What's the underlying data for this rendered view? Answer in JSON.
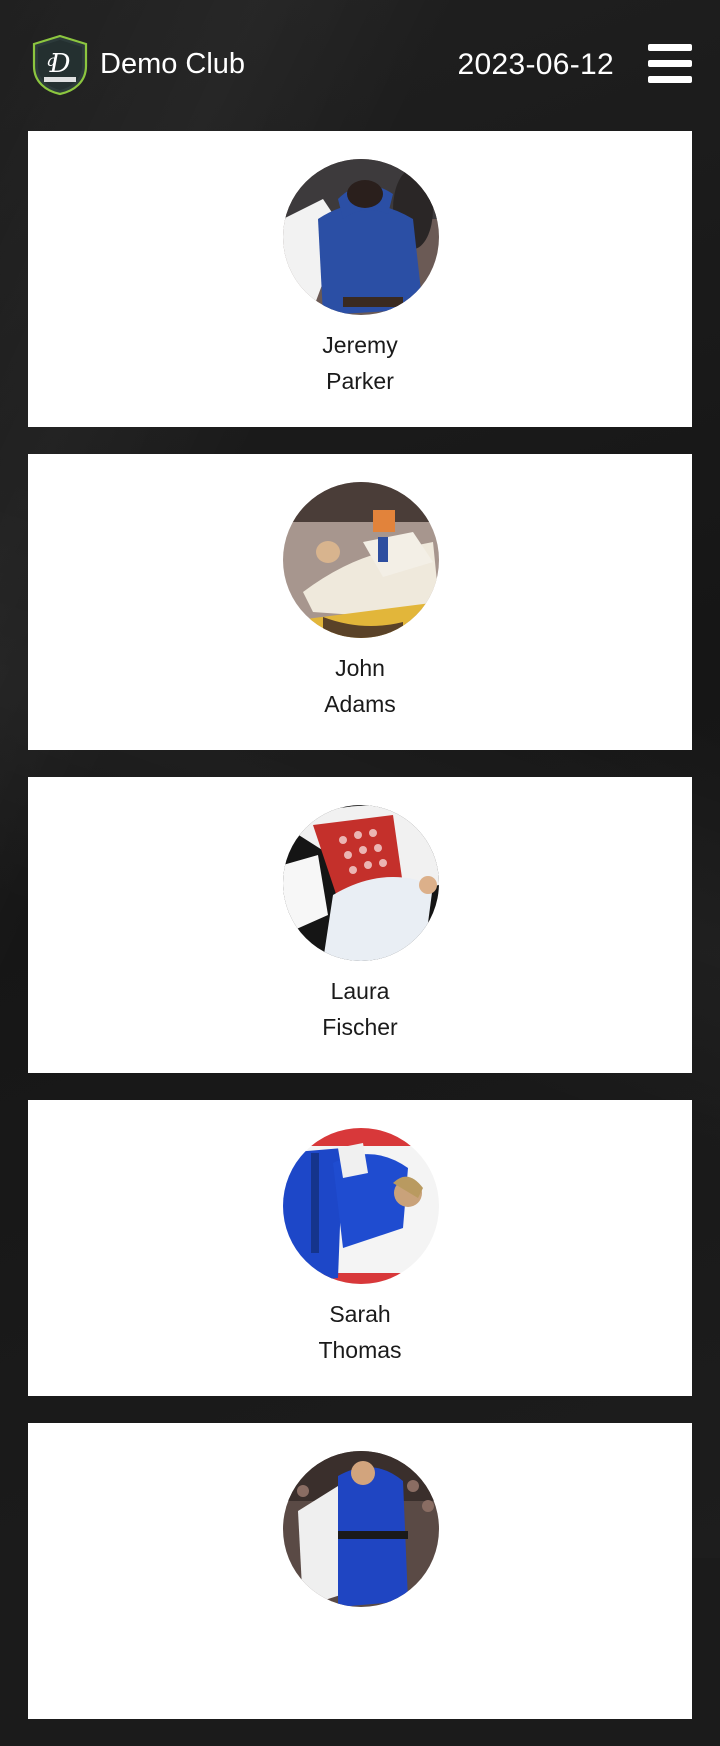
{
  "header": {
    "club_name": "Demo Club",
    "date": "2023-06-12",
    "logo_icon": "club-shield-logo",
    "menu_icon": "hamburger-menu-icon"
  },
  "members": [
    {
      "first_name": "Jeremy",
      "last_name": "Parker",
      "photo": "judoka-blue-gi-photo"
    },
    {
      "first_name": "John",
      "last_name": "Adams",
      "photo": "judo-groundwork-photo"
    },
    {
      "first_name": "Laura",
      "last_name": "Fischer",
      "photo": "taekwondo-red-vest-photo"
    },
    {
      "first_name": "Sarah",
      "last_name": "Thomas",
      "photo": "judo-throw-blue-gi-photo"
    },
    {
      "first_name": "",
      "last_name": "",
      "photo": "judo-match-photo"
    }
  ],
  "colors": {
    "background": "#1b1b1b",
    "card": "#ffffff",
    "text_light": "#ffffff",
    "text_dark": "#1a1a1a",
    "logo_accent": "#8cc63f"
  }
}
